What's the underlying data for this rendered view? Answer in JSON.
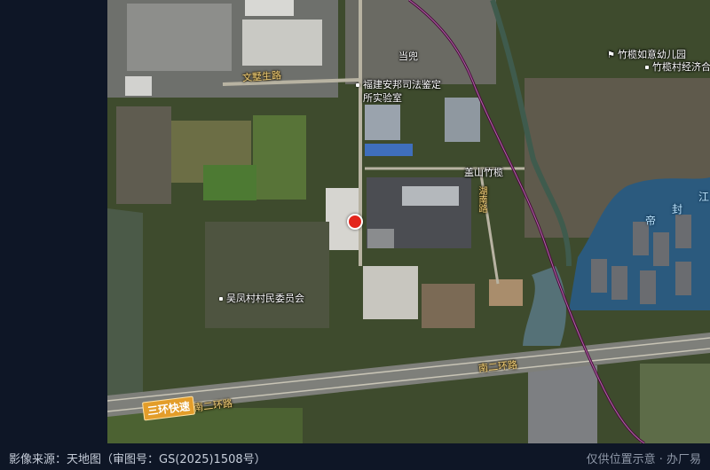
{
  "map": {
    "marker_color": "#e3251c",
    "transit_line_color": "#4a0a3c",
    "pois": [
      {
        "text": "当兜",
        "icon": "none"
      },
      {
        "text": "竹榄如意幼儿园",
        "icon": "school-flag-icon"
      },
      {
        "text": "竹榄村经济合",
        "icon": "dot-icon"
      },
      {
        "text": "福建安邦司法鉴定",
        "icon": "dot-icon"
      },
      {
        "text": "所实验室",
        "icon": "none"
      },
      {
        "text": "盖山竹榄",
        "icon": "none"
      },
      {
        "text": "吴凤村村民委员会",
        "icon": "dot-icon"
      }
    ],
    "roads": {
      "wenshu": "文墅生路",
      "side_vertical": "湖南路",
      "ring2_upper": "南二环路",
      "ring2_lower": "南二环路",
      "expressway": "三环快速"
    },
    "water": [
      "帝",
      "封",
      "江"
    ]
  },
  "footer": {
    "source": "影像来源：天地图（审图号：GS(2025)1508号）",
    "note": "仅供位置示意 · 办厂易"
  }
}
